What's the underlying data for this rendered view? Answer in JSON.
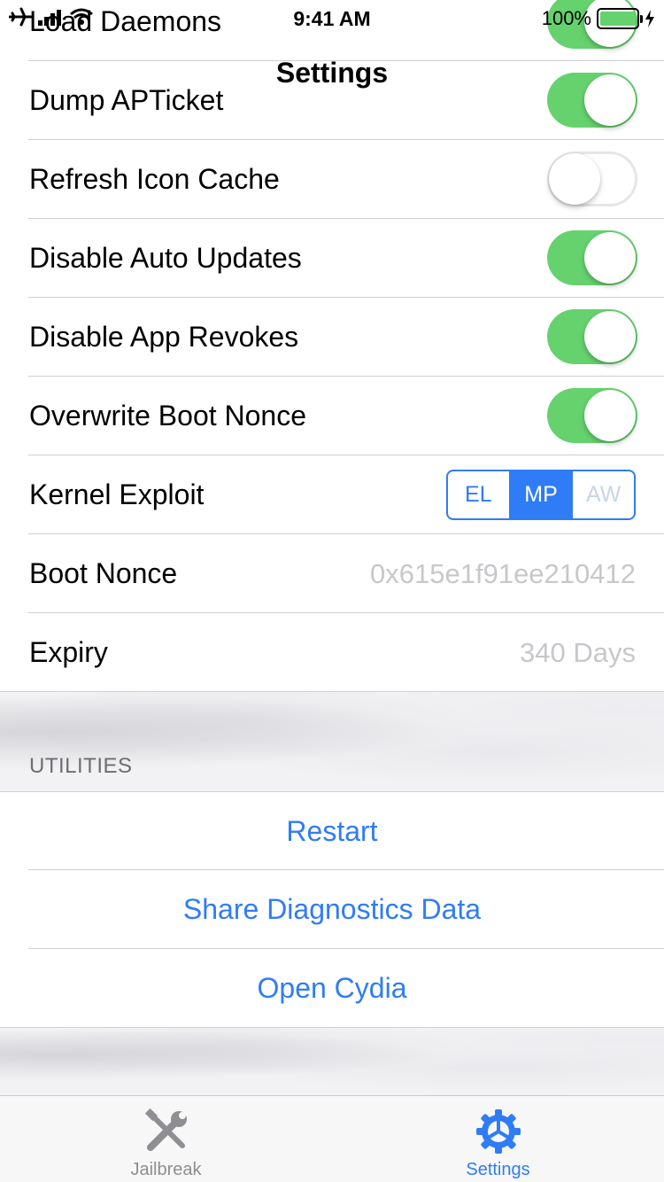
{
  "status_bar": {
    "time": "9:41 AM",
    "battery_percent": "100%",
    "battery_level": 1.0,
    "icons": [
      "airplane-icon",
      "signal-icon",
      "wifi-icon",
      "battery-icon",
      "charging-icon"
    ]
  },
  "nav": {
    "title": "Settings"
  },
  "settings": [
    {
      "label": "Load Daemons",
      "on": true
    },
    {
      "label": "Dump APTicket",
      "on": true
    },
    {
      "label": "Refresh Icon Cache",
      "on": false
    },
    {
      "label": "Disable Auto Updates",
      "on": true
    },
    {
      "label": "Disable App Revokes",
      "on": true
    },
    {
      "label": "Overwrite Boot Nonce",
      "on": true
    }
  ],
  "kernel_exploit": {
    "label": "Kernel Exploit",
    "options": [
      "EL",
      "MP",
      "AW"
    ],
    "selected": "MP",
    "disabled": [
      "AW"
    ]
  },
  "boot_nonce": {
    "label": "Boot Nonce",
    "value": "0x615e1f91ee210412"
  },
  "expiry": {
    "label": "Expiry",
    "value": "340 Days"
  },
  "utilities": {
    "header": "UTILITIES",
    "actions": [
      "Restart",
      "Share Diagnostics Data",
      "Open Cydia"
    ]
  },
  "tab_bar": {
    "tabs": [
      {
        "label": "Jailbreak",
        "icon": "wrench-screwdriver-icon",
        "active": false
      },
      {
        "label": "Settings",
        "icon": "gear-icon",
        "active": true
      }
    ]
  },
  "colors": {
    "accent": "#2f7cf6",
    "switch_on": "#65d26e",
    "secondary_text": "#c7c7cc",
    "section_header": "#6d6d72"
  }
}
